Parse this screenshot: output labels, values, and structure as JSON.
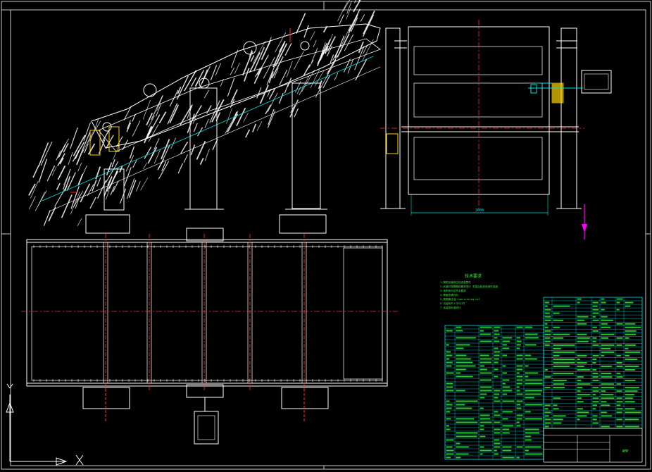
{
  "drawing": {
    "notes_title": "技术要求",
    "notes": [
      "1.筛机安装前应检查各零件",
      "2.安装时按照图纸要求进行 安装后检查各部件连接",
      "3.电机转向应符合要求",
      "4.筛面张紧均匀",
      "5.激振器注油 Lubricating oil",
      "6.试运转不少于2小时",
      "7.涂装按标准执行"
    ],
    "dimension_label": "3000",
    "title_block_label": "AMP",
    "colors": {
      "background": "#000000",
      "outline": "#ffffff",
      "centerline": "#ff3030",
      "dimension": "#00e0e0",
      "table": "#00e0e0",
      "table_text": "#38f838",
      "notes": "#38f838",
      "spring": "#ffd400",
      "magenta": "#ff00ff",
      "frame": "#c8c8c8"
    }
  }
}
